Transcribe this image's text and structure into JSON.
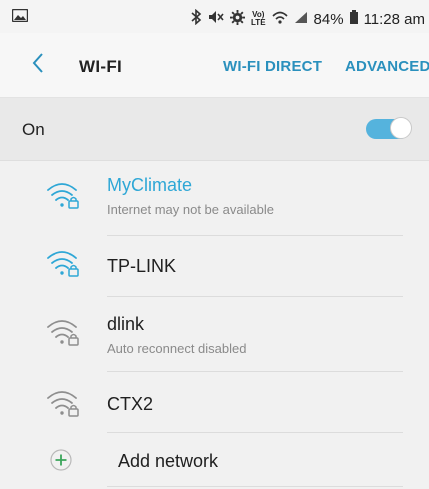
{
  "status_bar": {
    "battery": "84%",
    "time": "11:28 am",
    "volte": "Vo)",
    "lte": "LTE"
  },
  "app_bar": {
    "title": "WI-FI",
    "wifi_direct": "WI-FI DIRECT",
    "advanced": "ADVANCED"
  },
  "toggle": {
    "label": "On",
    "state": "on"
  },
  "networks": [
    {
      "name": "MyClimate",
      "subtitle": "Internet may not be available",
      "strength": "strong",
      "color": "#2ea7d6"
    },
    {
      "name": "TP-LINK",
      "subtitle": "",
      "strength": "strong",
      "color": "#2ea7d6"
    },
    {
      "name": "dlink",
      "subtitle": "Auto reconnect disabled",
      "strength": "weak",
      "color": "#8e8e8e"
    },
    {
      "name": "CTX2",
      "subtitle": "",
      "strength": "weak",
      "color": "#8e8e8e"
    }
  ],
  "add_network": {
    "label": "Add network"
  },
  "colors": {
    "accent": "#2ea7d6",
    "action_text": "#2a90bd",
    "switch_on": "#55b3dd",
    "add_icon": "#3aa55a"
  }
}
